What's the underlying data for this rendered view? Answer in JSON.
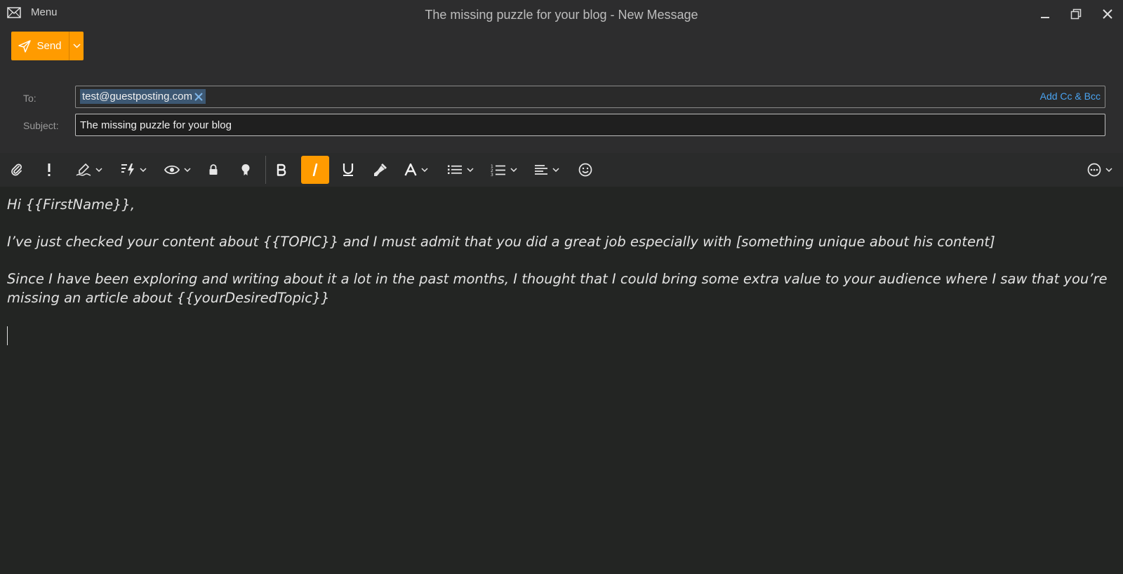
{
  "window": {
    "menu_label": "Menu",
    "title": "The missing puzzle for your blog - New Message"
  },
  "send": {
    "label": "Send"
  },
  "compose": {
    "to_label": "To:",
    "recipient": "test@guestposting.com",
    "add_cc_bcc": "Add Cc & Bcc",
    "subject_label": "Subject:",
    "subject_value": "The missing puzzle for your blog"
  },
  "toolbar": {
    "italic_active": true,
    "buttons": [
      "attach-icon",
      "importance-icon",
      "signature-icon",
      "quick-text-icon",
      "read-receipt-icon",
      "encrypt-icon",
      "badge-icon",
      "bold",
      "italic",
      "underline",
      "format-painter-icon",
      "font-icon",
      "bullet-list-icon",
      "numbered-list-icon",
      "align-icon",
      "emoji-icon",
      "more-icon"
    ]
  },
  "body": {
    "line1": "Hi {{FirstName}},",
    "line2": "I’ve just checked your content about {{TOPIC}} and I must admit that you did a great job especially with [something unique about his content]",
    "line3": "Since I have been exploring and writing about it a lot in the past months, I thought that I could bring some extra value to your audience where I saw that you’re missing an article about {{yourDesiredTopic}}"
  },
  "colors": {
    "accent": "#ff9b00",
    "link": "#4aa3f0",
    "chip": "#3d5873",
    "background": "#232523",
    "header": "#2d2d2e"
  }
}
